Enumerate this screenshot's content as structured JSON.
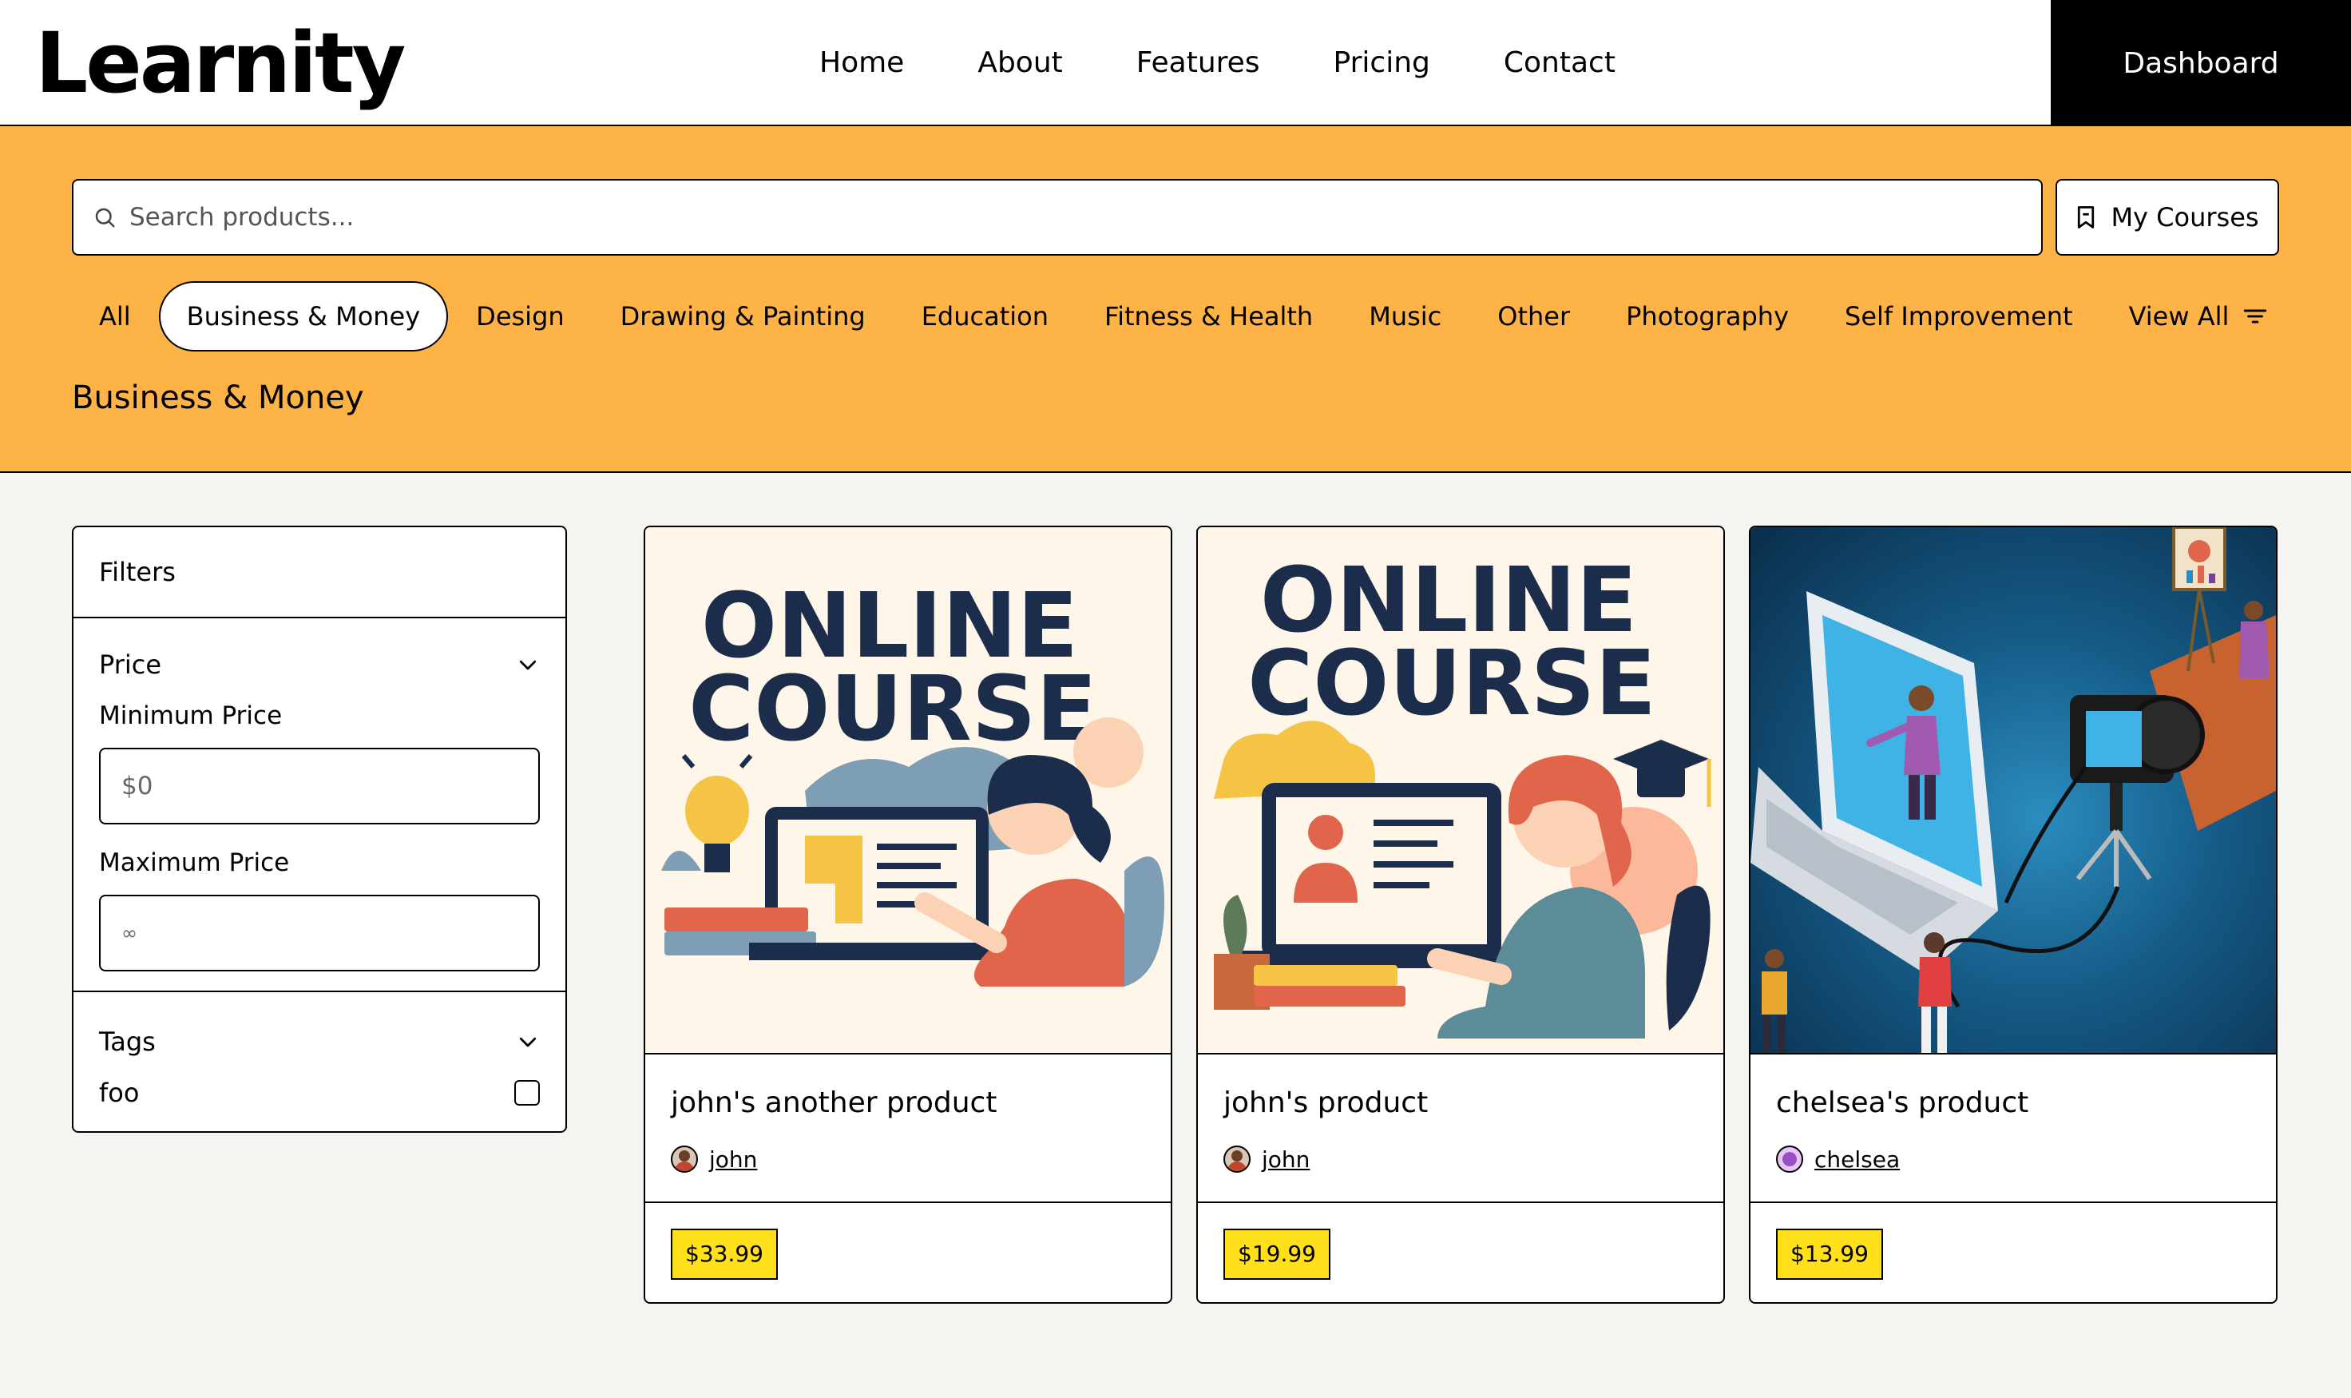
{
  "brand": "Learnity",
  "nav": {
    "links": [
      "Home",
      "About",
      "Features",
      "Pricing",
      "Contact"
    ],
    "dashboard_label": "Dashboard"
  },
  "search": {
    "placeholder": "Search products..."
  },
  "my_courses_label": "My Courses",
  "categories": [
    "All",
    "Business & Money",
    "Design",
    "Drawing & Painting",
    "Education",
    "Fitness & Health",
    "Music",
    "Other",
    "Photography",
    "Self Improvement",
    "View All"
  ],
  "active_category": "Business & Money",
  "page_title": "Business & Money",
  "filters": {
    "title": "Filters",
    "price": {
      "label": "Price",
      "min_label": "Minimum Price",
      "min_placeholder": "$0",
      "max_label": "Maximum Price",
      "max_placeholder": "∞"
    },
    "tags": {
      "label": "Tags",
      "items": [
        {
          "name": "foo",
          "checked": false
        }
      ]
    }
  },
  "products": [
    {
      "title": "john's another product",
      "author": "john",
      "price": "$33.99",
      "image_text": [
        "ONLINE",
        "COURSE"
      ]
    },
    {
      "title": "john's product",
      "author": "john",
      "price": "$19.99",
      "image_text": [
        "ONLINE",
        "COURSE"
      ]
    },
    {
      "title": "chelsea's product",
      "author": "chelsea",
      "price": "$13.99"
    }
  ],
  "colors": {
    "band": "#feb347",
    "price_tag": "#ffe019",
    "background": "#f4f4f0",
    "navy": "#1b2d4a"
  }
}
